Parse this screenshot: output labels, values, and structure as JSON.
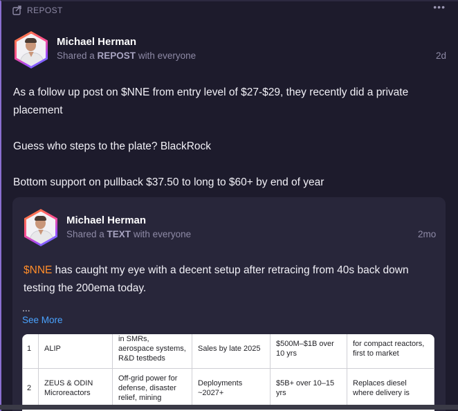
{
  "header": {
    "repost_label": "REPOST",
    "more": "•••"
  },
  "post": {
    "author": "Michael Herman",
    "share_prefix": "Shared a ",
    "share_type": "REPOST",
    "share_suffix": " with everyone",
    "time": "2d",
    "paragraphs": [
      "As a follow up post on $NNE from entry level of $27-$29, they recently did a private placement",
      "Guess who steps to the plate? BlackRock",
      "Bottom support on pullback $37.50 to long to $60+ by end of year"
    ]
  },
  "quoted": {
    "author": "Michael Herman",
    "share_prefix": "Shared a ",
    "share_type": "TEXT",
    "share_suffix": " with everyone",
    "time": "2mo",
    "ticker": "$NNE",
    "text_rest": " has caught my eye with a decent setup after retracing  from 40s back down testing the 200ema today.",
    "ellipsis": "...",
    "see_more": "See More",
    "table": [
      [
        "1",
        "ALIP",
        "in SMRs, aerospace systems, R&D testbeds",
        "Sales by late 2025",
        "$500M–$1B over 10 yrs",
        "for compact reactors, first to market"
      ],
      [
        "2",
        "ZEUS & ODIN Microreactors",
        "Off-grid power for defense, disaster relief, mining",
        "Deployments ~2027+",
        "$5B+ over 10–15 yrs",
        "Replaces diesel where delivery is"
      ]
    ]
  },
  "colors": {
    "accent_ticker": "#ff8c2a",
    "link": "#4aa3ff",
    "card_bg": "#1d1b2c",
    "quoted_bg": "#28263a"
  }
}
